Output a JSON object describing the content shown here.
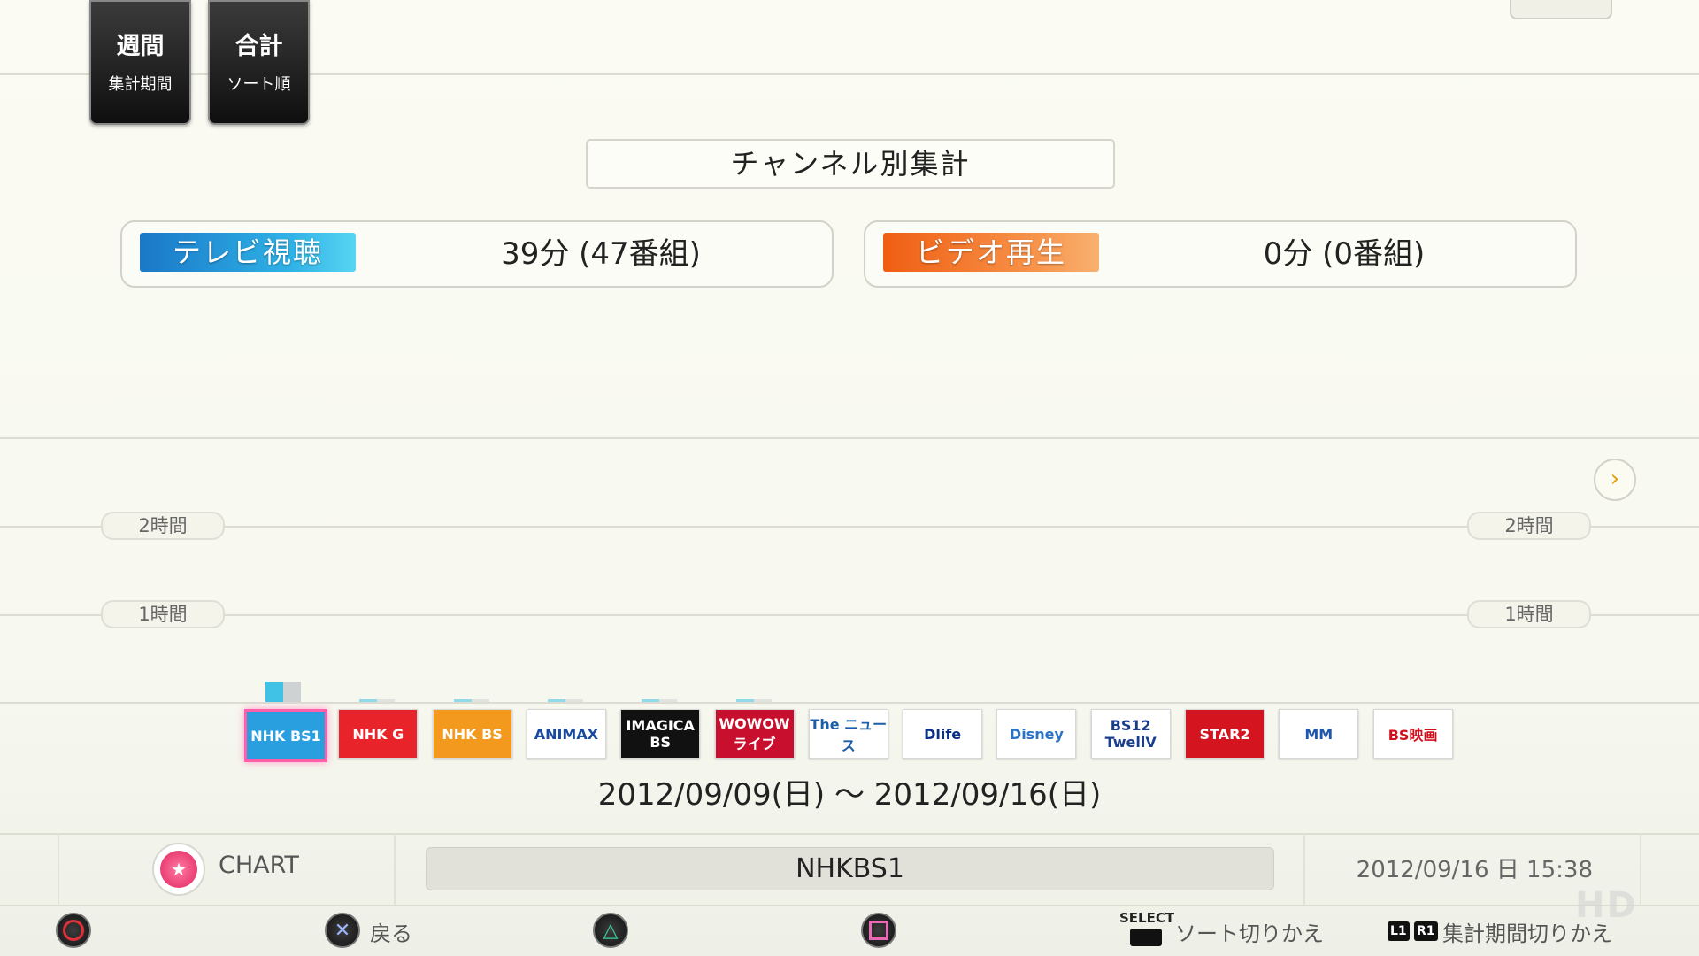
{
  "top_tiles": [
    {
      "big": "週間",
      "small": "集計期間"
    },
    {
      "big": "合計",
      "small": "ソート順"
    }
  ],
  "title": "チャンネル別集計",
  "summary": {
    "tv": {
      "label": "テレビ視聴",
      "value": "39分 (47番組)"
    },
    "video": {
      "label": "ビデオ再生",
      "value": "0分 (0番組)"
    }
  },
  "axis": {
    "two_hours": "2時間",
    "one_hour": "1時間"
  },
  "chart_data": {
    "type": "bar",
    "categories": [
      "NHK BS1",
      "NHK G",
      "NHK BS",
      "ANIMAX",
      "IMAGICA BS",
      "WOWOW ライブ",
      "The ニュース",
      "Dlife",
      "Disney",
      "BS12 TwellV",
      "STAR2",
      "MM",
      "BS映画"
    ],
    "values_minutes": [
      14,
      2,
      2,
      2,
      2,
      1,
      0,
      0,
      0,
      0,
      0,
      0,
      0
    ],
    "ylim_hours": [
      0,
      2
    ],
    "selected": "NHK BS1"
  },
  "logos": [
    {
      "text": "NHK BS1",
      "bg": "#2a9fe0",
      "fg": "#ffffff"
    },
    {
      "text": "NHK G",
      "bg": "#e8232a",
      "fg": "#ffffff"
    },
    {
      "text": "NHK BS",
      "bg": "#f39a1e",
      "fg": "#ffffff"
    },
    {
      "text": "ANIMAX",
      "bg": "#ffffff",
      "fg": "#1a4aa0"
    },
    {
      "text": "IMAGICA BS",
      "bg": "#111111",
      "fg": "#ffffff"
    },
    {
      "text": "WOWOW ライブ",
      "bg": "#c8102e",
      "fg": "#ffffff"
    },
    {
      "text": "The ニュース",
      "bg": "#ffffff",
      "fg": "#1b5fa8"
    },
    {
      "text": "Dlife",
      "bg": "#ffffff",
      "fg": "#0c2f86"
    },
    {
      "text": "Disney",
      "bg": "#ffffff",
      "fg": "#2b73c6"
    },
    {
      "text": "BS12 TwellV",
      "bg": "#ffffff",
      "fg": "#1a3d8c"
    },
    {
      "text": "STAR2",
      "bg": "#d4141f",
      "fg": "#ffffff"
    },
    {
      "text": "MM",
      "bg": "#ffffff",
      "fg": "#1f56b0"
    },
    {
      "text": "BS映画",
      "bg": "#ffffff",
      "fg": "#d10f1c"
    }
  ],
  "date_range": "2012/09/09(日) 〜 2012/09/16(日)",
  "footer": {
    "chart_label": "CHART",
    "channel": "NHKBS1",
    "datetime": "2012/09/16 日 15:38"
  },
  "buttons": {
    "back": "戻る",
    "select_key": "SELECT",
    "sort_toggle": "ソート切りかえ",
    "l1": "L1",
    "r1": "R1",
    "period_toggle": "集計期間切りかえ"
  },
  "watermark": "HD"
}
